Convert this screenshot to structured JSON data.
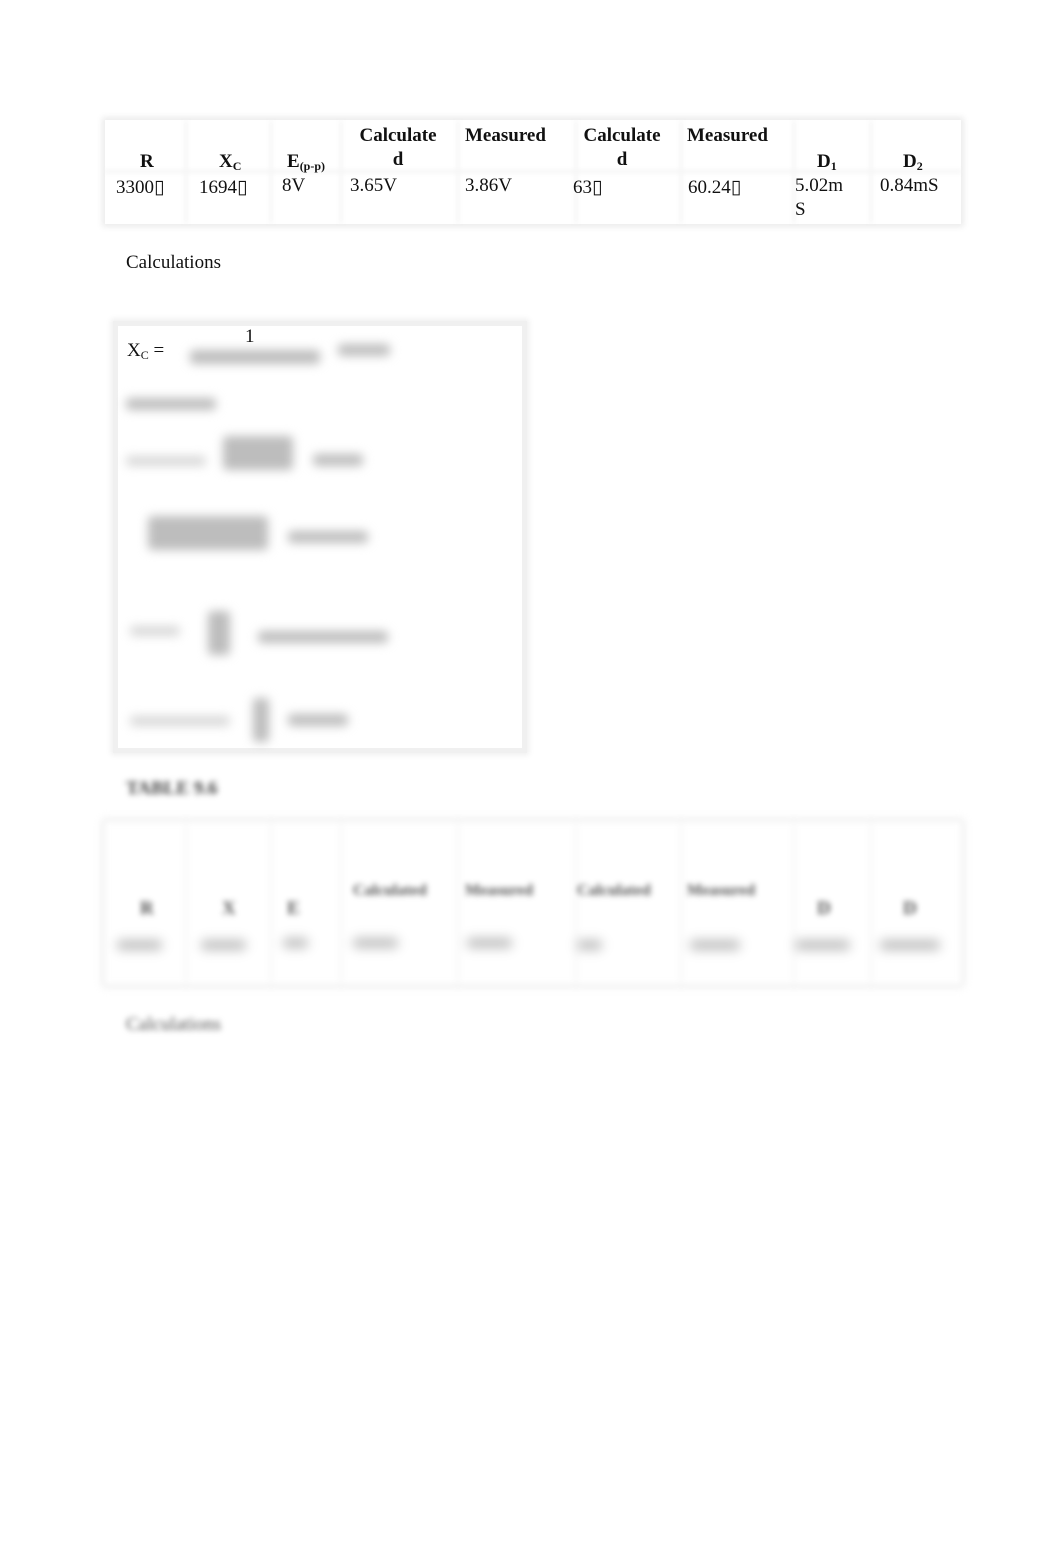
{
  "table1": {
    "headers": {
      "r": "R",
      "xc_main": "X",
      "xc_sub": "C",
      "e_main": "E",
      "e_sub": "(p-p)",
      "vc_calculated": "Calculate\nd",
      "vc_measured": "Measured",
      "ang_calculated": "Calculate\nd",
      "ang_measured": "Measured",
      "d1_main": "D",
      "d1_sub": "1",
      "d2_main": "D",
      "d2_sub": "2"
    },
    "row": {
      "r": "3300▯",
      "xc": "1694▯",
      "e": "8V",
      "vc_calculated": "3.65V",
      "vc_measured": "3.86V",
      "ang_calculated": "63▯",
      "ang_measured": "60.24▯",
      "d1": "5.02m\nS",
      "d2": "0.84mS"
    }
  },
  "calculations": {
    "label": "Calculations",
    "xc_lhs_main": "X",
    "xc_lhs_sub": "C",
    "xc_equals": "=",
    "xc_numerator": "1"
  },
  "table2": {
    "title": "TABLE 9.6",
    "headers": [
      "R",
      "X",
      "E",
      "Calculated",
      "Measured",
      "Calculated",
      "Measured",
      "D",
      "D"
    ]
  },
  "calculations2": {
    "label": "Calculations"
  }
}
